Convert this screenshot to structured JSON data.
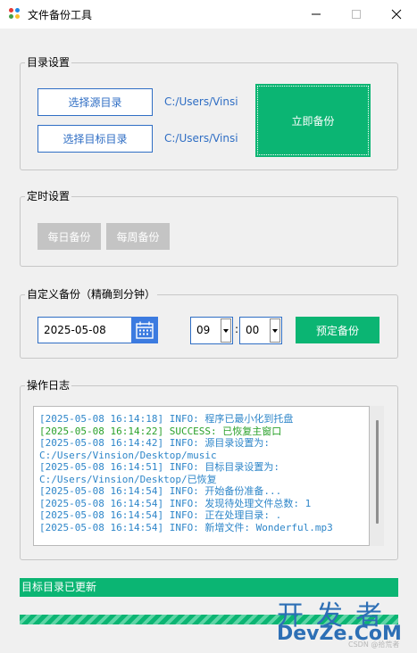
{
  "window": {
    "title": "文件备份工具"
  },
  "directory_settings": {
    "title": "目录设置",
    "select_source_label": "选择源目录",
    "select_target_label": "选择目标目录",
    "source_path": "C:/Users/Vinsi",
    "target_path": "C:/Users/Vinsi",
    "backup_now_label": "立即备份"
  },
  "timer_settings": {
    "title": "定时设置",
    "daily_label": "每日备份",
    "weekly_label": "每周备份"
  },
  "custom_backup": {
    "title": "自定义备份（精确到分钟）",
    "date_value": "2025-05-08",
    "hour_value": "09",
    "minute_value": "00",
    "separator": ":",
    "schedule_label": "预定备份"
  },
  "log": {
    "title": "操作日志",
    "lines": [
      "[2025-05-08 16:14:18] INFO: 程序已最小化到托盘",
      "[2025-05-08 16:14:22] SUCCESS: 已恢复主窗口",
      "[2025-05-08 16:14:42] INFO: 源目录设置为:",
      "C:/Users/Vinsion/Desktop/music",
      "[2025-05-08 16:14:51] INFO: 目标目录设置为:",
      "C:/Users/Vinsion/Desktop/已恢复",
      "[2025-05-08 16:14:54] INFO: 开始备份准备...",
      "[2025-05-08 16:14:54] INFO: 发现待处理文件总数: 1",
      "[2025-05-08 16:14:54] INFO: 正在处理目录: .",
      "[2025-05-08 16:14:54] INFO: 新增文件: Wonderful.mp3"
    ]
  },
  "status": {
    "text": "目标目录已更新",
    "progress": 1.0
  },
  "watermark": {
    "cn": "开发者",
    "en": "DevZe.CoM",
    "sub": "CSDN @拾荒者"
  },
  "colors": {
    "accent_green": "#0bb573",
    "accent_blue": "#2f6ec4",
    "log_info": "#2e86c9",
    "log_success": "#2aa12a"
  }
}
